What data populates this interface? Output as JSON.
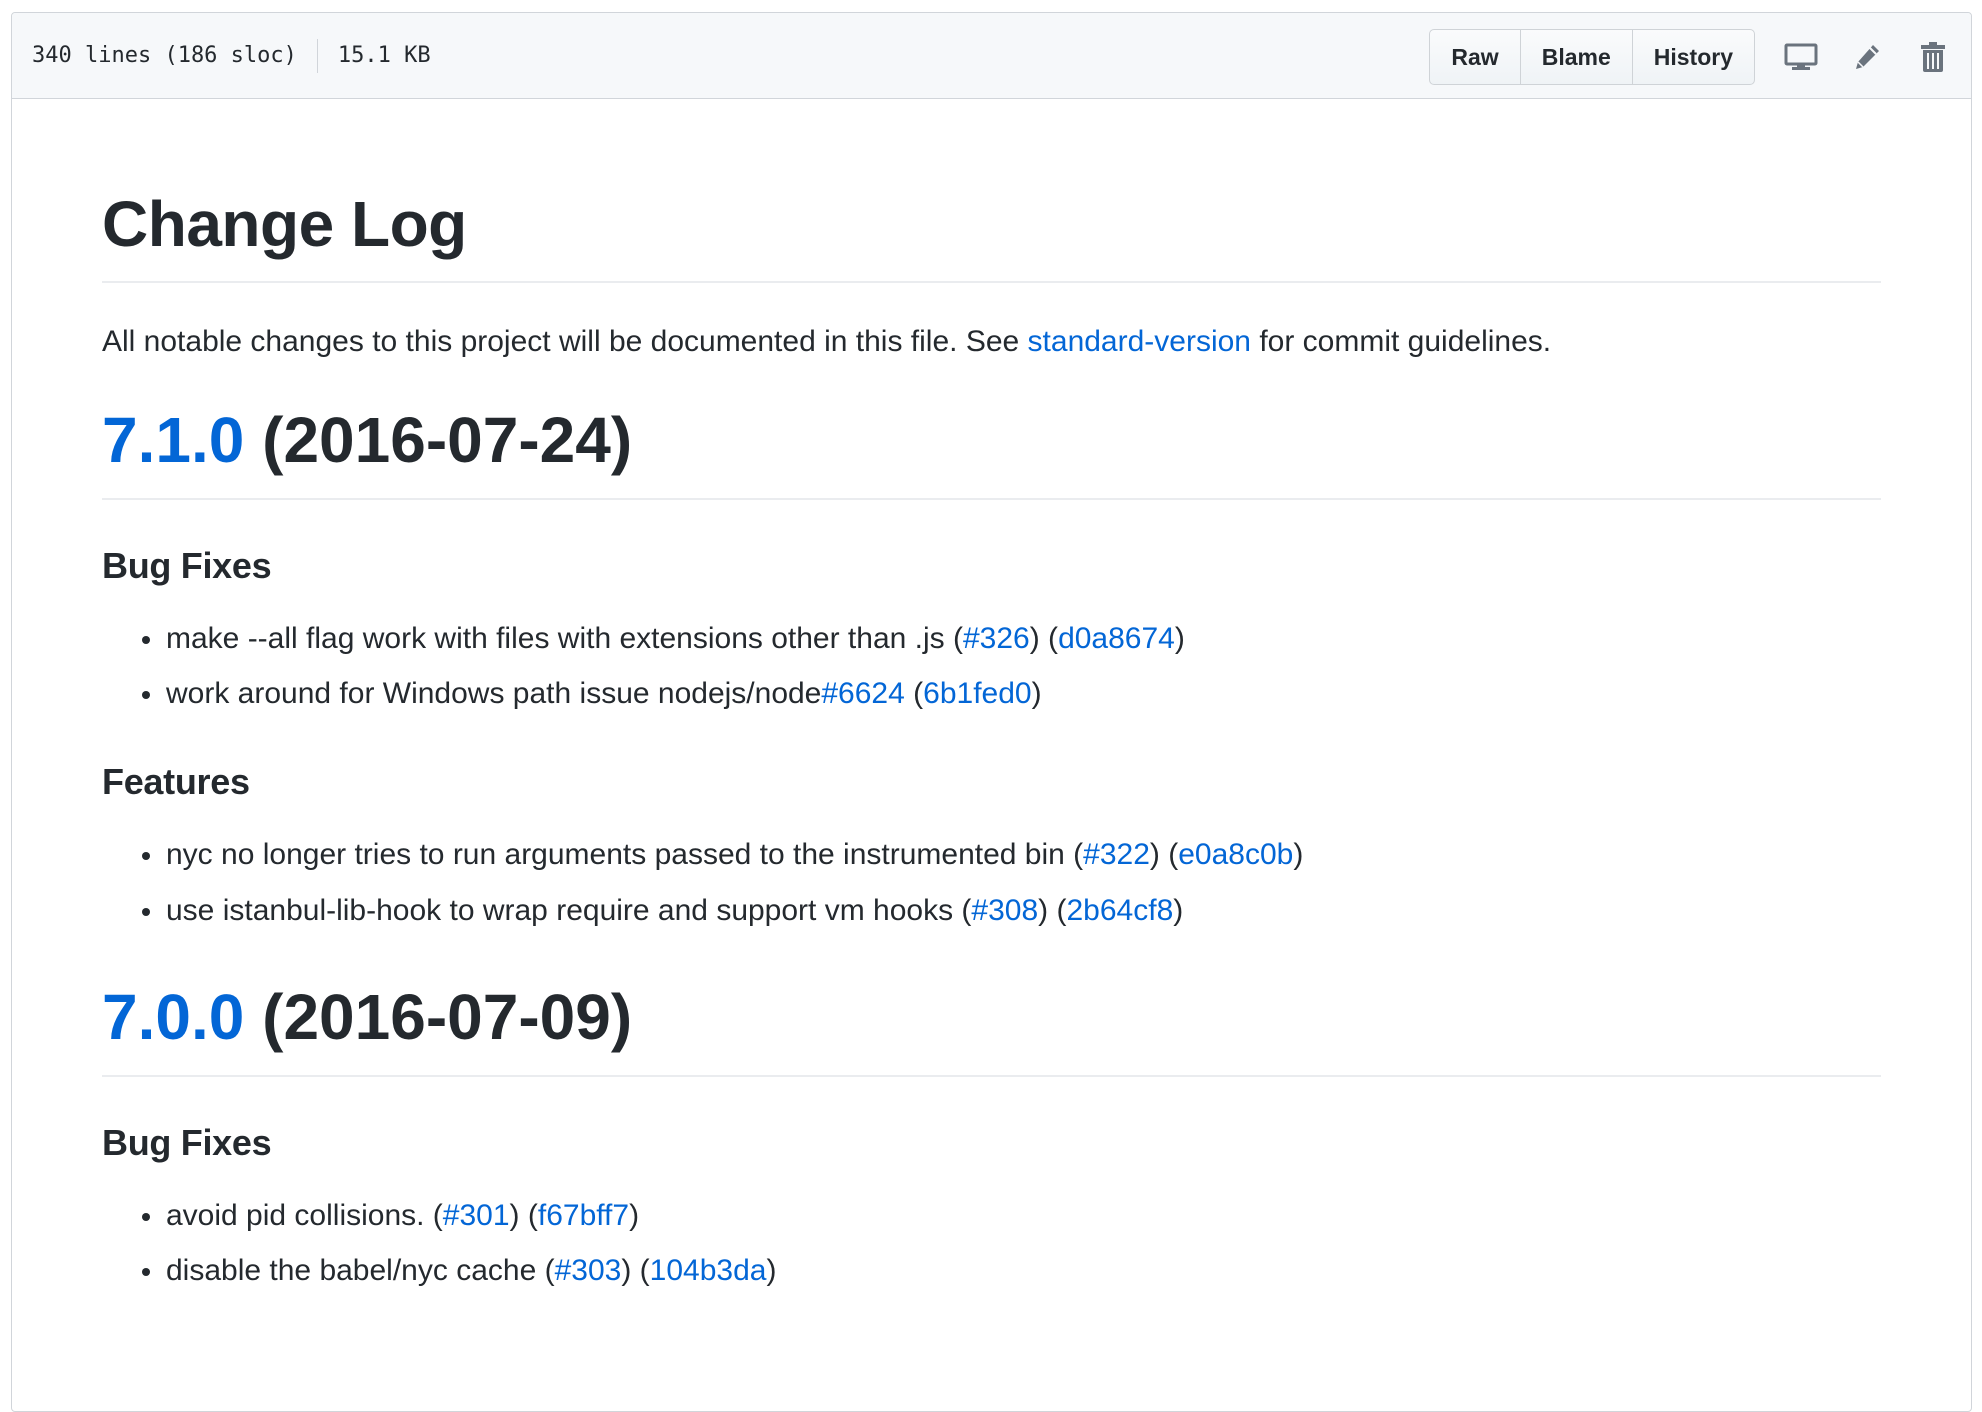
{
  "file_header": {
    "lines_info": "340 lines (186 sloc)",
    "size": "15.1 KB",
    "buttons": {
      "raw": "Raw",
      "blame": "Blame",
      "history": "History"
    },
    "icons": [
      "desktop-icon",
      "pencil-icon",
      "trash-icon"
    ]
  },
  "content": {
    "title": "Change Log",
    "intro_before": "All notable changes to this project will be documented in this file. See ",
    "intro_link": "standard-version",
    "intro_after": " for commit guidelines.",
    "releases": [
      {
        "version": "7.1.0",
        "date": " (2016-07-24)",
        "sections": [
          {
            "heading": "Bug Fixes",
            "items": [
              {
                "text": "make --all flag work with files with extensions other than .js (",
                "issue": "#326",
                "mid": ") (",
                "commit": "d0a8674",
                "end": ")"
              },
              {
                "text": "work around for Windows path issue nodejs/node",
                "issue": "#6624",
                "mid": " (",
                "commit": "6b1fed0",
                "end": ")"
              }
            ]
          },
          {
            "heading": "Features",
            "items": [
              {
                "text": "nyc no longer tries to run arguments passed to the instrumented bin (",
                "issue": "#322",
                "mid": ") (",
                "commit": "e0a8c0b",
                "end": ")"
              },
              {
                "text": "use istanbul-lib-hook to wrap require and support vm hooks (",
                "issue": "#308",
                "mid": ") (",
                "commit": "2b64cf8",
                "end": ")"
              }
            ]
          }
        ]
      },
      {
        "version": "7.0.0",
        "date": " (2016-07-09)",
        "sections": [
          {
            "heading": "Bug Fixes",
            "items": [
              {
                "text": "avoid pid collisions. (",
                "issue": "#301",
                "mid": ") (",
                "commit": "f67bff7",
                "end": ")"
              },
              {
                "text": "disable the babel/nyc cache (",
                "issue": "#303",
                "mid": ") (",
                "commit": "104b3da",
                "end": ")"
              }
            ]
          }
        ]
      }
    ]
  },
  "colors": {
    "link": "#4078c0",
    "text": "#24292e",
    "border": "#d1d5da",
    "header_bg": "#f6f8fa"
  }
}
